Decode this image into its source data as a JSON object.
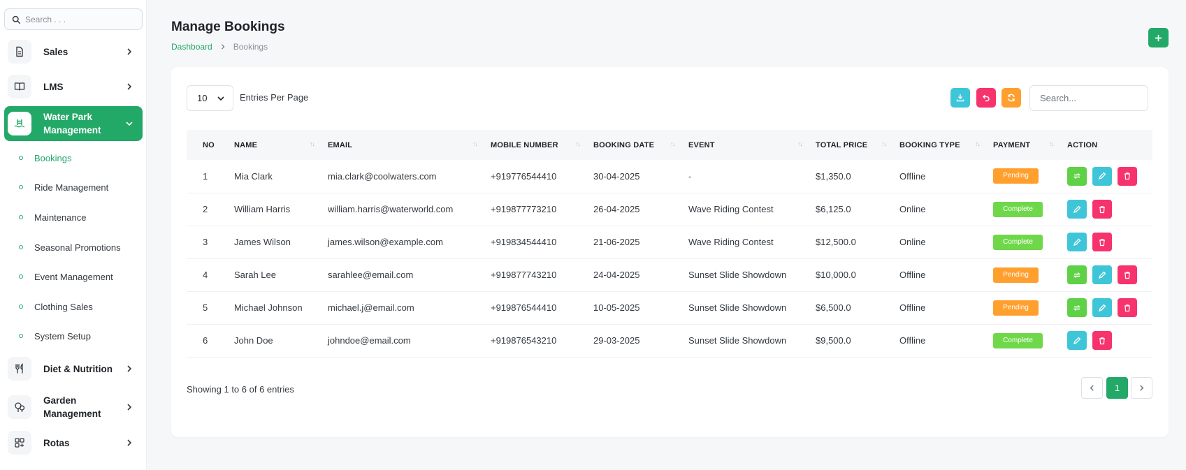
{
  "sidebar": {
    "search_placeholder": "Search . . .",
    "items": [
      {
        "label": "Sales",
        "icon": "file-icon"
      },
      {
        "label": "LMS",
        "icon": "book-icon"
      },
      {
        "label": "Water Park Management",
        "icon": "pool-icon",
        "active": true
      },
      {
        "label": "Diet & Nutrition",
        "icon": "utensils-icon"
      },
      {
        "label": "Garden Management",
        "icon": "tree-icon"
      },
      {
        "label": "Rotas",
        "icon": "grid-icon"
      }
    ],
    "sub_items": [
      "Bookings",
      "Ride Management",
      "Maintenance",
      "Seasonal Promotions",
      "Event Management",
      "Clothing Sales",
      "System Setup"
    ]
  },
  "header": {
    "title": "Manage Bookings",
    "breadcrumb_home": "Dashboard",
    "breadcrumb_current": "Bookings"
  },
  "toolbar": {
    "entries_value": "10",
    "entries_label": "Entries Per Page",
    "search_placeholder": "Search...",
    "colors": {
      "export": "#3ec6d8",
      "undo": "#f7336d",
      "refresh": "#ff9f2e",
      "accent": "#22a867"
    }
  },
  "table": {
    "columns": [
      "NO",
      "NAME",
      "EMAIL",
      "MOBILE NUMBER",
      "BOOKING DATE",
      "EVENT",
      "TOTAL PRICE",
      "BOOKING TYPE",
      "PAYMENT",
      "ACTION"
    ],
    "rows": [
      {
        "no": "1",
        "name": "Mia Clark",
        "email": "mia.clark@coolwaters.com",
        "mobile": "+919776544410",
        "date": "30-04-2025",
        "event": "-",
        "price": "$1,350.0",
        "type": "Offline",
        "payment": "Pending"
      },
      {
        "no": "2",
        "name": "William Harris",
        "email": "william.harris@waterworld.com",
        "mobile": "+919877773210",
        "date": "26-04-2025",
        "event": "Wave Riding Contest",
        "price": "$6,125.0",
        "type": "Online",
        "payment": "Complete"
      },
      {
        "no": "3",
        "name": "James Wilson",
        "email": "james.wilson@example.com",
        "mobile": "+919834544410",
        "date": "21-06-2025",
        "event": "Wave Riding Contest",
        "price": "$12,500.0",
        "type": "Online",
        "payment": "Complete"
      },
      {
        "no": "4",
        "name": "Sarah Lee",
        "email": "sarahlee@email.com",
        "mobile": "+919877743210",
        "date": "24-04-2025",
        "event": "Sunset Slide Showdown",
        "price": "$10,000.0",
        "type": "Offline",
        "payment": "Pending"
      },
      {
        "no": "5",
        "name": "Michael Johnson",
        "email": "michael.j@email.com",
        "mobile": "+919876544410",
        "date": "10-05-2025",
        "event": "Sunset Slide Showdown",
        "price": "$6,500.0",
        "type": "Offline",
        "payment": "Pending"
      },
      {
        "no": "6",
        "name": "John Doe",
        "email": "johndoe@email.com",
        "mobile": "+919876543210",
        "date": "29-03-2025",
        "event": "Sunset Slide Showdown",
        "price": "$9,500.0",
        "type": "Offline",
        "payment": "Complete"
      }
    ]
  },
  "footer": {
    "showing": "Showing 1 to 6 of 6 entries",
    "current_page": "1"
  }
}
